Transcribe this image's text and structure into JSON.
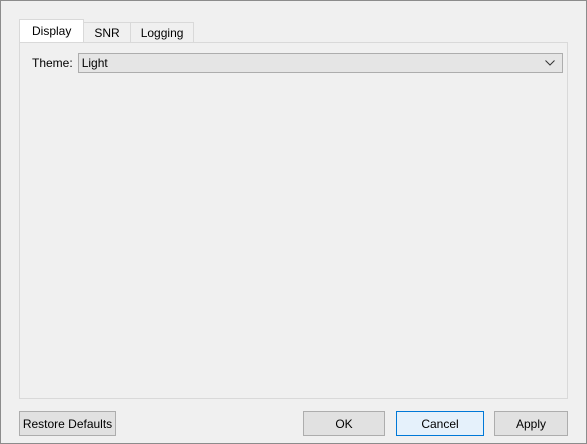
{
  "tabs": [
    {
      "label": "Display",
      "active": true
    },
    {
      "label": "SNR",
      "active": false
    },
    {
      "label": "Logging",
      "active": false
    }
  ],
  "display": {
    "theme_label": "Theme:",
    "theme_value": "Light"
  },
  "icons": {
    "combo_arrow": "chevron-down-icon"
  },
  "buttons": {
    "restore_defaults": "Restore Defaults",
    "ok": "OK",
    "cancel": "Cancel",
    "apply": "Apply"
  },
  "colors": {
    "default_button_border": "#0078d7",
    "default_button_bg": "#e5f1fb"
  }
}
